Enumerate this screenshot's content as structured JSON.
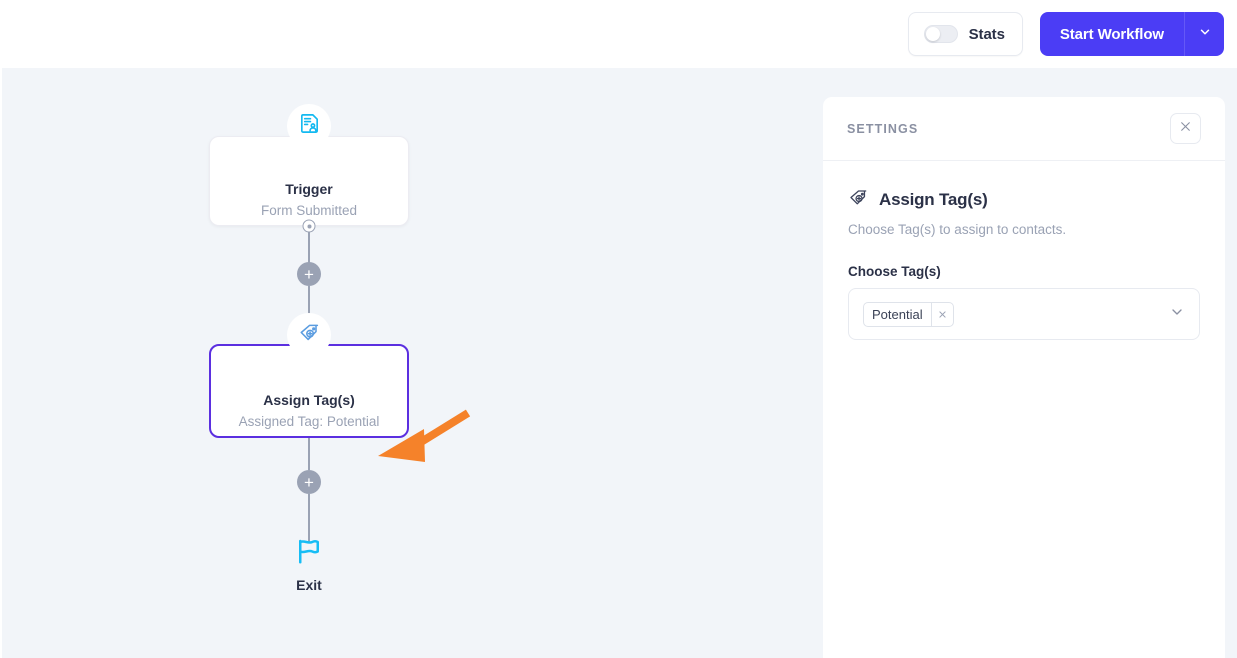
{
  "topbar": {
    "stats_toggle_label": "Stats",
    "stats_toggle_state": "off",
    "start_button_label": "Start Workflow",
    "start_caret_icon": "chevron-down-icon",
    "accent_color": "#4b3df5"
  },
  "canvas": {
    "background_color": "#f2f5f9",
    "nodes": [
      {
        "icon": "form-person-icon",
        "title": "Trigger",
        "subtitle": "Form Submitted",
        "selected": false
      },
      {
        "icon": "tag-plus-icon",
        "title": "Assign Tag(s)",
        "subtitle": "Assigned Tag: Potential",
        "selected": true
      }
    ],
    "add_step_icon": "plus-icon",
    "exit": {
      "icon": "flag-icon",
      "label": "Exit"
    },
    "annotation": {
      "type": "arrow",
      "color": "#f5822a"
    }
  },
  "settings": {
    "header_title": "SETTINGS",
    "close_icon": "close-icon",
    "panel_icon": "tag-plus-icon",
    "panel_title": "Assign Tag(s)",
    "panel_description": "Choose Tag(s) to assign to contacts.",
    "field_label": "Choose Tag(s)",
    "selected_tags": [
      {
        "label": "Potential",
        "remove_icon": "close-icon"
      }
    ],
    "dropdown_icon": "chevron-down-icon"
  }
}
